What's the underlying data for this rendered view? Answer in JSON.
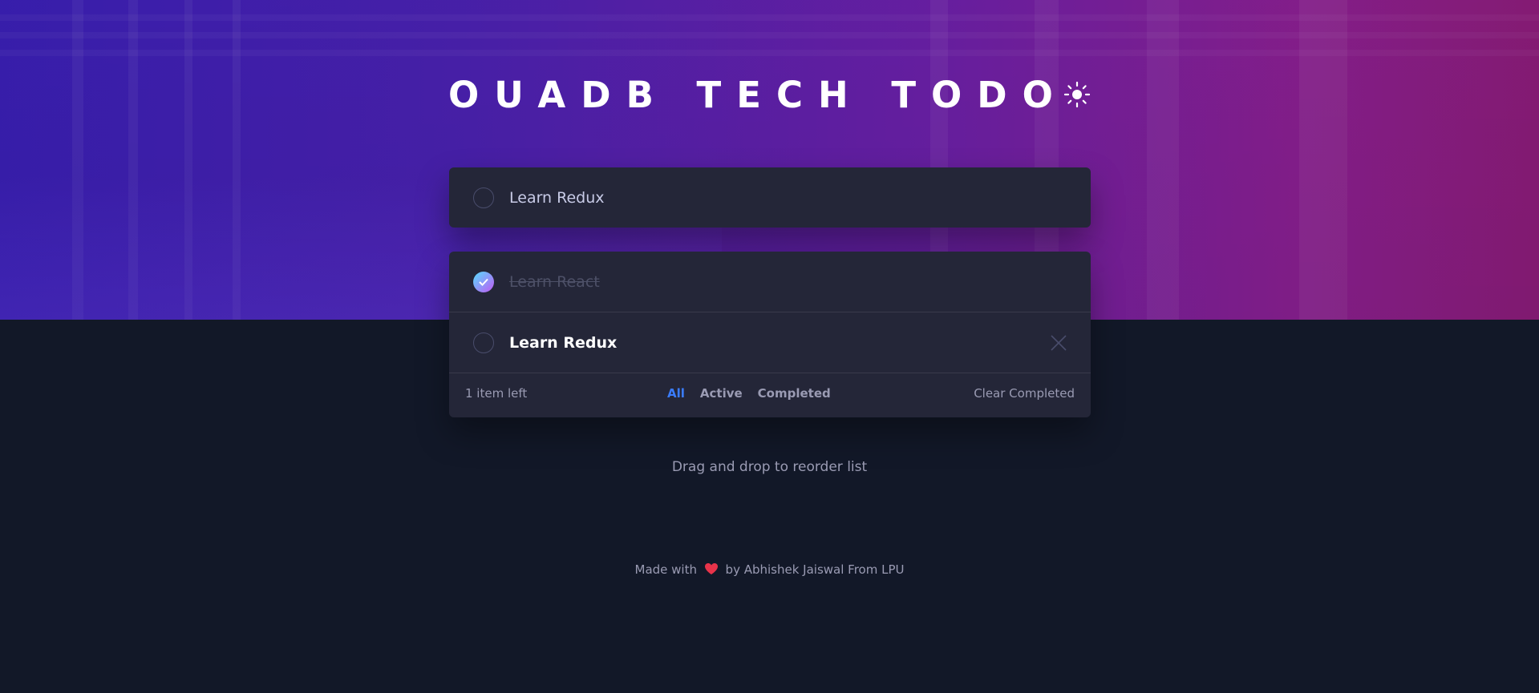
{
  "header": {
    "title": "OUADB TECH TODO",
    "theme_toggle_icon": "sun-icon"
  },
  "new_todo": {
    "text": "Learn Redux"
  },
  "todos": [
    {
      "text": "Learn React",
      "completed": true
    },
    {
      "text": "Learn Redux",
      "completed": false
    }
  ],
  "footer": {
    "items_left": "1 item left",
    "filters": [
      "All",
      "Active",
      "Completed"
    ],
    "active_filter": "All",
    "clear_label": "Clear Completed"
  },
  "hint": "Drag and drop to reorder list",
  "credit": {
    "before": "Made with",
    "icon": "heart-icon",
    "after": "by Abhishek Jaiswal From LPU"
  },
  "colors": {
    "accent": "#3a7cfd",
    "check_gradient_start": "#57ddff",
    "check_gradient_end": "#c058f3",
    "background": "#121828",
    "card": "#242638"
  }
}
